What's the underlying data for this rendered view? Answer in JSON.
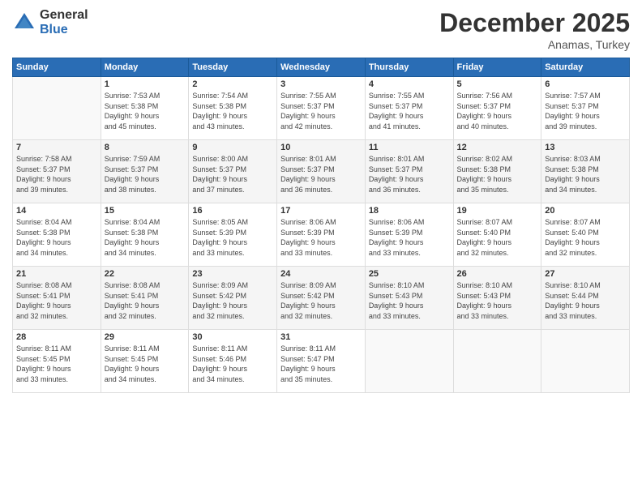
{
  "header": {
    "logo_general": "General",
    "logo_blue": "Blue",
    "title": "December 2025",
    "location": "Anamas, Turkey"
  },
  "days_of_week": [
    "Sunday",
    "Monday",
    "Tuesday",
    "Wednesday",
    "Thursday",
    "Friday",
    "Saturday"
  ],
  "weeks": [
    [
      {
        "num": "",
        "info": ""
      },
      {
        "num": "1",
        "info": "Sunrise: 7:53 AM\nSunset: 5:38 PM\nDaylight: 9 hours\nand 45 minutes."
      },
      {
        "num": "2",
        "info": "Sunrise: 7:54 AM\nSunset: 5:38 PM\nDaylight: 9 hours\nand 43 minutes."
      },
      {
        "num": "3",
        "info": "Sunrise: 7:55 AM\nSunset: 5:37 PM\nDaylight: 9 hours\nand 42 minutes."
      },
      {
        "num": "4",
        "info": "Sunrise: 7:55 AM\nSunset: 5:37 PM\nDaylight: 9 hours\nand 41 minutes."
      },
      {
        "num": "5",
        "info": "Sunrise: 7:56 AM\nSunset: 5:37 PM\nDaylight: 9 hours\nand 40 minutes."
      },
      {
        "num": "6",
        "info": "Sunrise: 7:57 AM\nSunset: 5:37 PM\nDaylight: 9 hours\nand 39 minutes."
      }
    ],
    [
      {
        "num": "7",
        "info": "Sunrise: 7:58 AM\nSunset: 5:37 PM\nDaylight: 9 hours\nand 39 minutes."
      },
      {
        "num": "8",
        "info": "Sunrise: 7:59 AM\nSunset: 5:37 PM\nDaylight: 9 hours\nand 38 minutes."
      },
      {
        "num": "9",
        "info": "Sunrise: 8:00 AM\nSunset: 5:37 PM\nDaylight: 9 hours\nand 37 minutes."
      },
      {
        "num": "10",
        "info": "Sunrise: 8:01 AM\nSunset: 5:37 PM\nDaylight: 9 hours\nand 36 minutes."
      },
      {
        "num": "11",
        "info": "Sunrise: 8:01 AM\nSunset: 5:37 PM\nDaylight: 9 hours\nand 36 minutes."
      },
      {
        "num": "12",
        "info": "Sunrise: 8:02 AM\nSunset: 5:38 PM\nDaylight: 9 hours\nand 35 minutes."
      },
      {
        "num": "13",
        "info": "Sunrise: 8:03 AM\nSunset: 5:38 PM\nDaylight: 9 hours\nand 34 minutes."
      }
    ],
    [
      {
        "num": "14",
        "info": "Sunrise: 8:04 AM\nSunset: 5:38 PM\nDaylight: 9 hours\nand 34 minutes."
      },
      {
        "num": "15",
        "info": "Sunrise: 8:04 AM\nSunset: 5:38 PM\nDaylight: 9 hours\nand 34 minutes."
      },
      {
        "num": "16",
        "info": "Sunrise: 8:05 AM\nSunset: 5:39 PM\nDaylight: 9 hours\nand 33 minutes."
      },
      {
        "num": "17",
        "info": "Sunrise: 8:06 AM\nSunset: 5:39 PM\nDaylight: 9 hours\nand 33 minutes."
      },
      {
        "num": "18",
        "info": "Sunrise: 8:06 AM\nSunset: 5:39 PM\nDaylight: 9 hours\nand 33 minutes."
      },
      {
        "num": "19",
        "info": "Sunrise: 8:07 AM\nSunset: 5:40 PM\nDaylight: 9 hours\nand 32 minutes."
      },
      {
        "num": "20",
        "info": "Sunrise: 8:07 AM\nSunset: 5:40 PM\nDaylight: 9 hours\nand 32 minutes."
      }
    ],
    [
      {
        "num": "21",
        "info": "Sunrise: 8:08 AM\nSunset: 5:41 PM\nDaylight: 9 hours\nand 32 minutes."
      },
      {
        "num": "22",
        "info": "Sunrise: 8:08 AM\nSunset: 5:41 PM\nDaylight: 9 hours\nand 32 minutes."
      },
      {
        "num": "23",
        "info": "Sunrise: 8:09 AM\nSunset: 5:42 PM\nDaylight: 9 hours\nand 32 minutes."
      },
      {
        "num": "24",
        "info": "Sunrise: 8:09 AM\nSunset: 5:42 PM\nDaylight: 9 hours\nand 32 minutes."
      },
      {
        "num": "25",
        "info": "Sunrise: 8:10 AM\nSunset: 5:43 PM\nDaylight: 9 hours\nand 33 minutes."
      },
      {
        "num": "26",
        "info": "Sunrise: 8:10 AM\nSunset: 5:43 PM\nDaylight: 9 hours\nand 33 minutes."
      },
      {
        "num": "27",
        "info": "Sunrise: 8:10 AM\nSunset: 5:44 PM\nDaylight: 9 hours\nand 33 minutes."
      }
    ],
    [
      {
        "num": "28",
        "info": "Sunrise: 8:11 AM\nSunset: 5:45 PM\nDaylight: 9 hours\nand 33 minutes."
      },
      {
        "num": "29",
        "info": "Sunrise: 8:11 AM\nSunset: 5:45 PM\nDaylight: 9 hours\nand 34 minutes."
      },
      {
        "num": "30",
        "info": "Sunrise: 8:11 AM\nSunset: 5:46 PM\nDaylight: 9 hours\nand 34 minutes."
      },
      {
        "num": "31",
        "info": "Sunrise: 8:11 AM\nSunset: 5:47 PM\nDaylight: 9 hours\nand 35 minutes."
      },
      {
        "num": "",
        "info": ""
      },
      {
        "num": "",
        "info": ""
      },
      {
        "num": "",
        "info": ""
      }
    ]
  ]
}
